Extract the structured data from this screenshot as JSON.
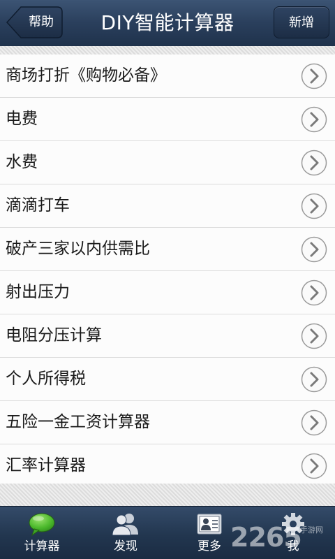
{
  "header": {
    "title": "DIY智能计算器",
    "back_label": "帮助",
    "add_label": "新增"
  },
  "list": {
    "items": [
      {
        "label": "商场打折《购物必备》"
      },
      {
        "label": "电费"
      },
      {
        "label": "水费"
      },
      {
        "label": "滴滴打车"
      },
      {
        "label": "破产三家以内供需比"
      },
      {
        "label": "射出压力"
      },
      {
        "label": "电阻分压计算"
      },
      {
        "label": "个人所得税"
      },
      {
        "label": "五险一金工资计算器"
      },
      {
        "label": "汇率计算器"
      }
    ]
  },
  "tabbar": {
    "tabs": [
      {
        "label": "计算器",
        "icon": "chat-bubble-icon",
        "active": true
      },
      {
        "label": "发现",
        "icon": "people-icon"
      },
      {
        "label": "更多",
        "icon": "contact-card-icon"
      },
      {
        "label": "我",
        "icon": "gear-icon"
      }
    ]
  },
  "watermark": {
    "number": "2265",
    "text": "手游网"
  },
  "colors": {
    "header": "#2a3f5c",
    "active_icon": "#3fae2a",
    "chevron": "#8a8a8a"
  }
}
